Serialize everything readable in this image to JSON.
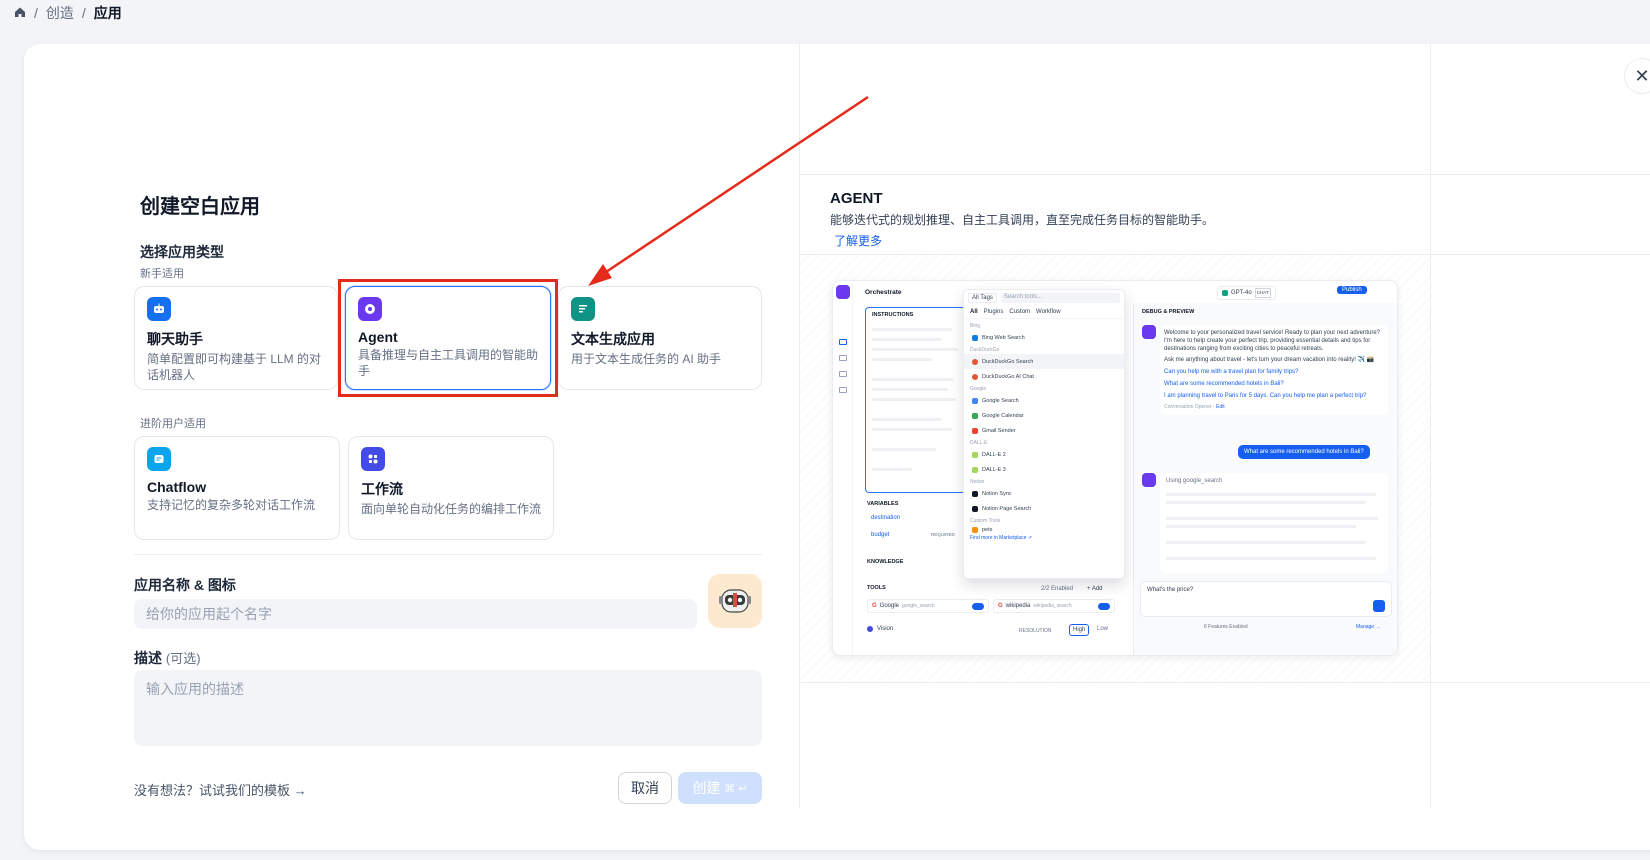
{
  "breadcrumb": {
    "items": [
      "创造",
      "应用"
    ],
    "separator": "/"
  },
  "left": {
    "title": "创建空白应用",
    "type_heading": "选择应用类型",
    "groups": [
      {
        "label": "新手适用",
        "cards": [
          {
            "title": "聊天助手",
            "desc": "简单配置即可构建基于 LLM 的对话机器人",
            "icon": "chat-bot-icon",
            "color": "#1570ef"
          },
          {
            "title": "Agent",
            "desc": "具备推理与自主工具调用的智能助手",
            "icon": "agent-brain-icon",
            "color": "#6938ef",
            "selected": true
          },
          {
            "title": "文本生成应用",
            "desc": "用于文本生成任务的 AI 助手",
            "icon": "text-generator-icon",
            "color": "#0e9384"
          }
        ]
      },
      {
        "label": "进阶用户适用",
        "cards": [
          {
            "title": "Chatflow",
            "desc": "支持记忆的复杂多轮对话工作流",
            "icon": "chatflow-icon",
            "color": "#0ba5ec"
          },
          {
            "title": "工作流",
            "desc": "面向单轮自动化任务的编排工作流",
            "icon": "workflow-icon",
            "color": "#444ce7"
          }
        ]
      }
    ],
    "name_label": "应用名称 & 图标",
    "name_placeholder": "给你的应用起个名字",
    "desc_label": "描述",
    "desc_optional": "(可选)",
    "desc_placeholder": "输入应用的描述",
    "template_link": "没有想法？试试我们的模板",
    "cancel": "取消",
    "create": "创建",
    "create_shortcut": "⌘ ↵"
  },
  "right": {
    "title": "AGENT",
    "desc": "能够迭代式的规划推理、自主工具调用，直至完成任务目标的智能助手。",
    "learn_more": "了解更多",
    "preview": {
      "orchestrate": "Orchestrate",
      "instructions": "INSTRUCTIONS",
      "model": "GPT-4o",
      "model_tag": "CHAT",
      "publish": "Publish",
      "debug": "DEBUG & PREVIEW",
      "all_tags": "All Tags",
      "search_tools": "Search tools...",
      "tabs": [
        "All",
        "Plugins",
        "Custom",
        "Workflow"
      ],
      "tool_groups": [
        {
          "name": "Bing",
          "items": [
            "Bing Web Search"
          ]
        },
        {
          "name": "DuckDuckGo",
          "items": [
            "DuckDuckGo Search",
            "DuckDuckGo AI Chat"
          ]
        },
        {
          "name": "Google",
          "items": [
            "Google Search",
            "Google Calendar",
            "Gmail Sender"
          ]
        },
        {
          "name": "DALL-E",
          "items": [
            "DALL-E 2",
            "DALL-E 3"
          ]
        },
        {
          "name": "Notion",
          "items": [
            "Notion Sync",
            "Notion Page Search"
          ]
        },
        {
          "name": "Custom Tools",
          "items": [
            "pets"
          ]
        }
      ],
      "find_more": "Find more in Marketplace ↗",
      "variables": "VARIABLES",
      "var_items": [
        "destination",
        "budget"
      ],
      "required": "REQUIRED",
      "knowledge": "KNOWLEDGE",
      "tools": "TOOLS",
      "tools_enabled": "2/2 Enabled",
      "add": "+ Add",
      "tool_google": "Google",
      "tool_google_sub": "google_search",
      "tool_wiki": "wikipedia",
      "tool_wiki_sub": "wikipedia_search",
      "vision": "Vision",
      "resolution": "RESOLUTION",
      "high": "High",
      "low": "Low",
      "welcome": "Welcome to your personalized travel service! Ready to plan your next adventure? I'm here to help create your perfect trip, providing essential details and tips for destinations ranging from exciting cities to peaceful retreats.",
      "ask": "Ask me anything about travel - let's turn your dream vacation into reality! ✈️ 📸",
      "suggestions": [
        "Can you help me with a travel plan for family trips?",
        "What are some recommended hotels in Bali?",
        "I am planning travel to Paris for 5 days. Can you help me plan a perfect trip?"
      ],
      "opener": "Conversation Opener",
      "edit": "Edit",
      "user_msg": "What are some recommended hotels in Bali?",
      "using": "Using",
      "using_tool": "google_search",
      "input_text": "What's the price?",
      "features": "6 Features Enabled",
      "manage": "Manage →"
    }
  }
}
